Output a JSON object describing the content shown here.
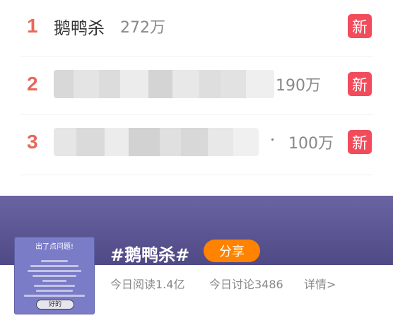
{
  "ranking": {
    "items": [
      {
        "rank": "1",
        "title": "鹅鸭杀",
        "count": "272万",
        "badge": "新"
      },
      {
        "rank": "2",
        "title": "",
        "count": "190万",
        "badge": "新"
      },
      {
        "rank": "3",
        "title": "",
        "count": "100万",
        "badge": "新"
      }
    ]
  },
  "topic": {
    "name": "#鹅鸭杀#",
    "share_label": "分享",
    "read_stat": "今日阅读1.4亿",
    "discuss_stat": "今日讨论3486",
    "detail_link": "详情>",
    "thumbnail": {
      "title": "出了点问题!",
      "button": "好的"
    }
  },
  "colors": {
    "rank_number": "#e8685a",
    "new_badge": "#f24b5b",
    "share_button": "#ff8300",
    "topic_banner": "#5b5694"
  }
}
